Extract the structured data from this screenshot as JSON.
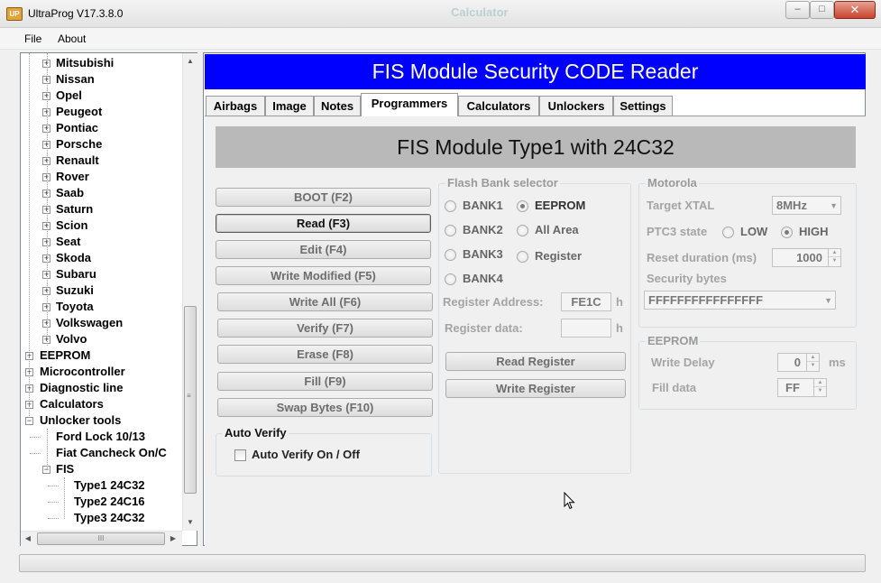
{
  "window": {
    "title": "UltraProg V17.3.8.0",
    "icon_label": "UP",
    "background_text": "Calculator",
    "controls": {
      "minimize": "–",
      "maximize": "□",
      "close": "✕"
    }
  },
  "menu": [
    "File",
    "About"
  ],
  "tree": {
    "items": [
      {
        "label": "Mitsubishi",
        "level": 1,
        "expander": "+"
      },
      {
        "label": "Nissan",
        "level": 1,
        "expander": "+"
      },
      {
        "label": "Opel",
        "level": 1,
        "expander": "+"
      },
      {
        "label": "Peugeot",
        "level": 1,
        "expander": "+"
      },
      {
        "label": "Pontiac",
        "level": 1,
        "expander": "+"
      },
      {
        "label": "Porsche",
        "level": 1,
        "expander": "+"
      },
      {
        "label": "Renault",
        "level": 1,
        "expander": "+"
      },
      {
        "label": "Rover",
        "level": 1,
        "expander": "+"
      },
      {
        "label": "Saab",
        "level": 1,
        "expander": "+"
      },
      {
        "label": "Saturn",
        "level": 1,
        "expander": "+"
      },
      {
        "label": "Scion",
        "level": 1,
        "expander": "+"
      },
      {
        "label": "Seat",
        "level": 1,
        "expander": "+"
      },
      {
        "label": "Skoda",
        "level": 1,
        "expander": "+"
      },
      {
        "label": "Subaru",
        "level": 1,
        "expander": "+"
      },
      {
        "label": "Suzuki",
        "level": 1,
        "expander": "+"
      },
      {
        "label": "Toyota",
        "level": 1,
        "expander": "+"
      },
      {
        "label": "Volkswagen",
        "level": 1,
        "expander": "+"
      },
      {
        "label": "Volvo",
        "level": 1,
        "expander": "+"
      },
      {
        "label": "EEPROM",
        "level": 0,
        "expander": "+"
      },
      {
        "label": "Microcontroller",
        "level": 0,
        "expander": "+"
      },
      {
        "label": "Diagnostic line",
        "level": 0,
        "expander": "+"
      },
      {
        "label": "Calculators",
        "level": 0,
        "expander": "+"
      },
      {
        "label": "Unlocker tools",
        "level": 0,
        "expander": "−"
      },
      {
        "label": "Ford Lock 10/13",
        "level": 1,
        "expander": ""
      },
      {
        "label": "Fiat Cancheck On/C",
        "level": 1,
        "expander": ""
      },
      {
        "label": "FIS",
        "level": 1,
        "expander": "−"
      },
      {
        "label": "Type1 24C32",
        "level": 2,
        "expander": ""
      },
      {
        "label": "Type2 24C16",
        "level": 2,
        "expander": ""
      },
      {
        "label": "Type3 24C32",
        "level": 2,
        "expander": ""
      }
    ],
    "scroll_arrows": {
      "up": "▲",
      "down": "▼",
      "left": "◀",
      "right": "▶"
    },
    "grip_v": "≡",
    "grip_h": "III"
  },
  "header": {
    "title": "FIS Module Security CODE Reader",
    "bg_color": "#0000ff"
  },
  "tabs": [
    "Airbags",
    "Image",
    "Notes",
    "Programmers",
    "Calculators",
    "Unlockers",
    "Settings"
  ],
  "active_tab": "Programmers",
  "content": {
    "subtitle": "FIS Module Type1 with 24C32",
    "buttons": [
      "BOOT (F2)",
      "Read (F3)",
      "Edit (F4)",
      "Write Modified (F5)",
      "Write All (F6)",
      "Verify (F7)",
      "Erase (F8)",
      "Fill (F9)",
      "Swap Bytes (F10)"
    ],
    "auto_verify": {
      "title": "Auto Verify",
      "checkbox_label": "Auto Verify On / Off",
      "checked": false
    },
    "flash_bank": {
      "title": "Flash Bank selector",
      "options": {
        "bank1": "BANK1",
        "bank2": "BANK2",
        "bank3": "BANK3",
        "bank4": "BANK4",
        "eeprom": "EEPROM",
        "all_area": "All Area",
        "register": "Register"
      },
      "selected": "EEPROM",
      "register_address_label": "Register Address:",
      "register_address_value": "FE1C",
      "register_data_label": "Register data:",
      "register_data_value": "",
      "hex_suffix": "h",
      "read_register_label": "Read Register",
      "write_register_label": "Write Register"
    },
    "motorola": {
      "title": "Motorola",
      "target_xtal_label": "Target XTAL",
      "target_xtal_value": "8MHz",
      "ptc3_label": "PTC3 state",
      "low_label": "LOW",
      "high_label": "HIGH",
      "ptc3_selected": "HIGH",
      "reset_duration_label": "Reset duration (ms)",
      "reset_duration_value": "1000",
      "security_bytes_label": "Security bytes",
      "security_bytes_value": "FFFFFFFFFFFFFFFF"
    },
    "eeprom": {
      "title": "EEPROM",
      "write_delay_label": "Write Delay",
      "write_delay_value": "0",
      "write_delay_unit": "ms",
      "fill_data_label": "Fill data",
      "fill_data_value": "FF"
    }
  }
}
